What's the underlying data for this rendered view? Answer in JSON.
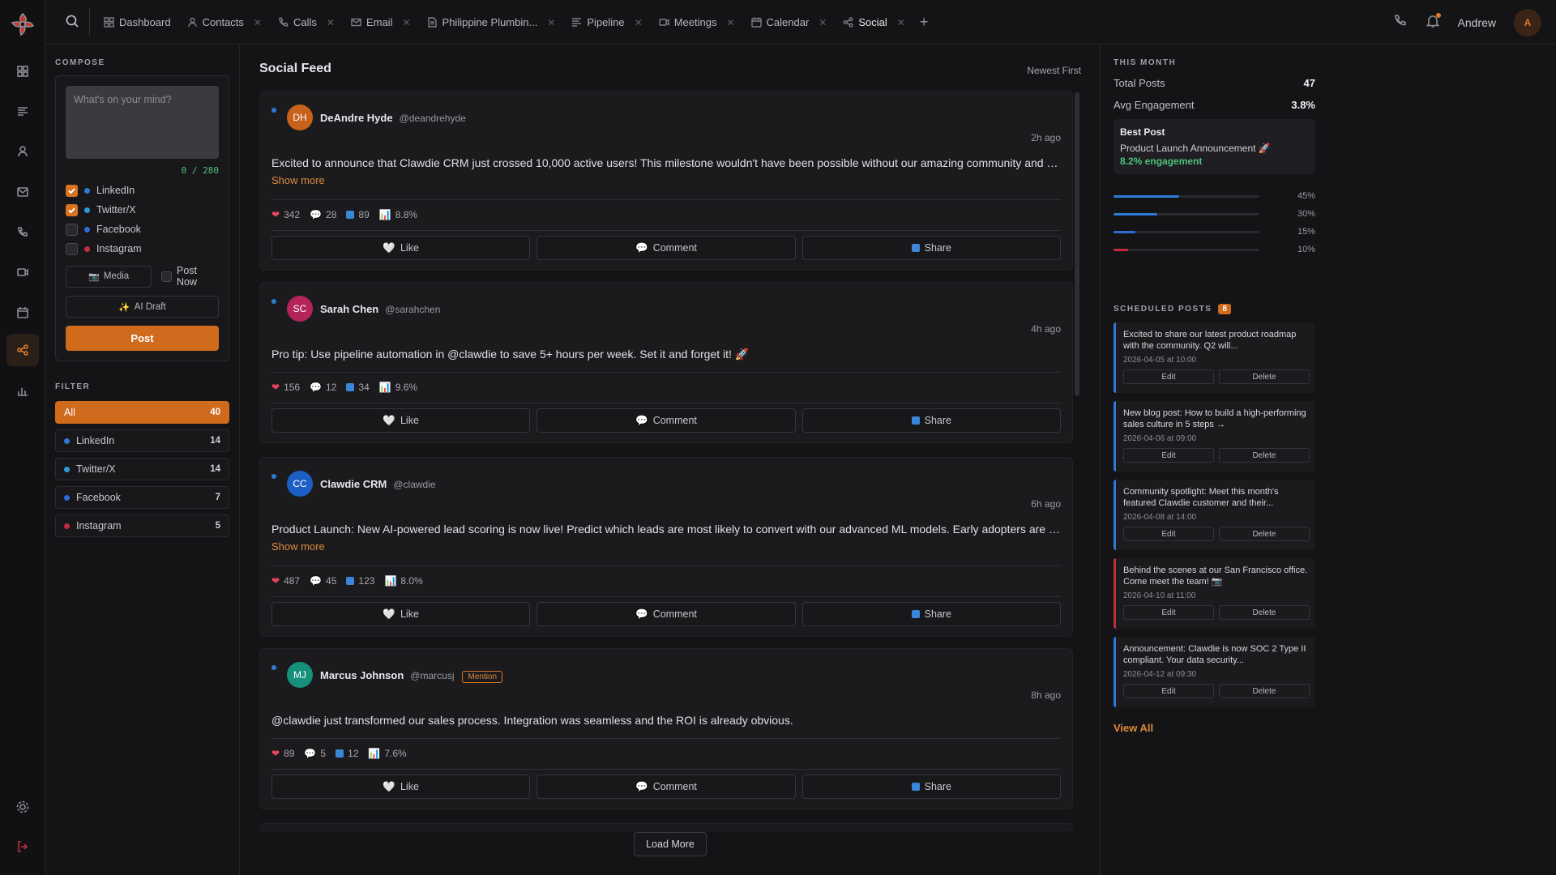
{
  "topbar": {
    "tabs": [
      {
        "label": "Dashboard",
        "icon": "grid-icon",
        "closable": false
      },
      {
        "label": "Contacts",
        "icon": "user-icon",
        "closable": true
      },
      {
        "label": "Calls",
        "icon": "phone-icon",
        "closable": true
      },
      {
        "label": "Email",
        "icon": "mail-icon",
        "closable": true
      },
      {
        "label": "Philippine Plumbin...",
        "icon": "document-icon",
        "closable": true
      },
      {
        "label": "Pipeline",
        "icon": "pipeline-icon",
        "closable": true
      },
      {
        "label": "Meetings",
        "icon": "video-icon",
        "closable": true
      },
      {
        "label": "Calendar",
        "icon": "calendar-icon",
        "closable": true
      },
      {
        "label": "Social",
        "icon": "share-icon",
        "closable": true,
        "active": true
      }
    ],
    "add_tab": "+",
    "user_name": "Andrew",
    "avatar_initial": "A"
  },
  "compose": {
    "label": "COMPOSE",
    "placeholder": "What's on your mind?",
    "char_count": "0 / 280",
    "networks": [
      {
        "name": "LinkedIn",
        "checked": true,
        "color": "#2d7bd6"
      },
      {
        "name": "Twitter/X",
        "checked": true,
        "color": "#2d9ad6"
      },
      {
        "name": "Facebook",
        "checked": false,
        "color": "#2d6bd6"
      },
      {
        "name": "Instagram",
        "checked": false,
        "color": "#c22c3f"
      }
    ],
    "media_label": "Media",
    "post_now_label": "Post Now",
    "ai_draft_label": "AI Draft",
    "post_label": "Post"
  },
  "filter": {
    "label": "FILTER",
    "items": [
      {
        "name": "All",
        "count": "40",
        "active": true
      },
      {
        "name": "LinkedIn",
        "count": "14",
        "color": "#2d7bd6"
      },
      {
        "name": "Twitter/X",
        "count": "14",
        "color": "#2d9ad6"
      },
      {
        "name": "Facebook",
        "count": "7",
        "color": "#2d6bd6"
      },
      {
        "name": "Instagram",
        "count": "5",
        "color": "#c22c3f"
      }
    ]
  },
  "feed": {
    "title": "Social Feed",
    "sort": "Newest First",
    "posts": [
      {
        "initials": "DH",
        "avatar_color": "#c8611c",
        "name": "DeAndre Hyde",
        "handle": "@deandrehyde",
        "time": "2h ago",
        "body": "Excited to announce that Clawdie CRM just crossed 10,000 active users! This milestone wouldn't have been possible without our amazing community and partners.",
        "show_more": "Show more",
        "likes": "342",
        "comments": "28",
        "shares": "89",
        "engagement": "8.8%",
        "mention": ""
      },
      {
        "initials": "SC",
        "avatar_color": "#b3245a",
        "name": "Sarah Chen",
        "handle": "@sarahchen",
        "time": "4h ago",
        "body": "Pro tip: Use pipeline automation in @clawdie to save 5+ hours per week. Set it and forget it! 🚀",
        "show_more": "",
        "likes": "156",
        "comments": "12",
        "shares": "34",
        "engagement": "9.6%",
        "mention": ""
      },
      {
        "initials": "CC",
        "avatar_color": "#1b5fc4",
        "name": "Clawdie CRM",
        "handle": "@clawdie",
        "time": "6h ago",
        "body": "Product Launch: New AI-powered lead scoring is now live! Predict which leads are most likely to convert with our advanced ML models. Early adopters are seeing great results.",
        "show_more": "Show more",
        "likes": "487",
        "comments": "45",
        "shares": "123",
        "engagement": "8.0%",
        "mention": ""
      },
      {
        "initials": "MJ",
        "avatar_color": "#16907a",
        "name": "Marcus Johnson",
        "handle": "@marcusj",
        "time": "8h ago",
        "body": "@clawdie just transformed our sales process. Integration was seamless and the ROI is already obvious.",
        "show_more": "",
        "likes": "89",
        "comments": "5",
        "shares": "12",
        "engagement": "7.6%",
        "mention": "Mention"
      }
    ],
    "like_label": "Like",
    "comment_label": "Comment",
    "share_label": "Share",
    "load_more": "Load More"
  },
  "stats": {
    "label": "THIS MONTH",
    "total_posts_label": "Total Posts",
    "total_posts": "47",
    "avg_eng_label": "Avg Engagement",
    "avg_eng": "3.8%",
    "best_label": "Best Post",
    "best_name": "Product Launch Announcement 🚀",
    "best_eng": "8.2% engagement",
    "bars": [
      {
        "value": 0.45,
        "label": "45%",
        "color": "#2d7bd6"
      },
      {
        "value": 0.3,
        "label": "30%",
        "color": "#2d7bd6"
      },
      {
        "value": 0.15,
        "label": "15%",
        "color": "#2d6bd6"
      },
      {
        "value": 0.1,
        "label": "10%",
        "color": "#c22c3f"
      }
    ]
  },
  "scheduled": {
    "label": "SCHEDULED POSTS",
    "count": "8",
    "items": [
      {
        "text": "Excited to share our latest product roadmap with the community. Q2 will...",
        "date": "2026-04-05 at 10:00",
        "accent": "blue"
      },
      {
        "text": "New blog post: How to build a high-performing sales culture in 5 steps →",
        "date": "2026-04-06 at 09:00",
        "accent": "blue"
      },
      {
        "text": "Community spotlight: Meet this month's featured Clawdie customer and their...",
        "date": "2026-04-08 at 14:00",
        "accent": "blue"
      },
      {
        "text": "Behind the scenes at our San Francisco office. Come meet the team! 📷",
        "date": "2026-04-10 at 11:00",
        "accent": "red"
      },
      {
        "text": "Announcement: Clawdie is now SOC 2 Type II compliant. Your data security...",
        "date": "2026-04-12 at 09:30",
        "accent": "blue"
      }
    ],
    "edit_label": "Edit",
    "delete_label": "Delete",
    "view_all": "View All"
  }
}
